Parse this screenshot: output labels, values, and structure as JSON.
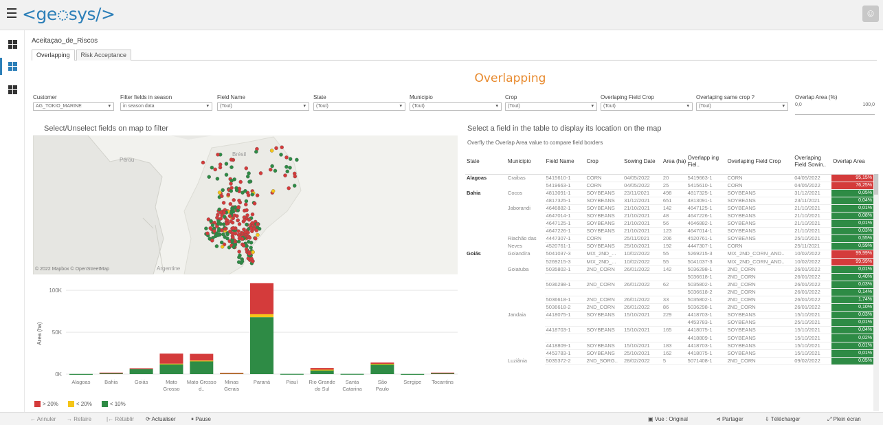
{
  "app": {
    "logo_prefix": "<ge",
    "logo_suffix": "sys/>",
    "avatar": "☺"
  },
  "sidenav": {
    "icons": [
      "dashboard-icon",
      "dashboard-icon",
      "dashboard-icon"
    ]
  },
  "workbook": {
    "title": "Aceitaçao_de_Riscos"
  },
  "tabs": [
    {
      "label": "Overlapping"
    },
    {
      "label": "Risk Acceptance"
    }
  ],
  "dashboard": {
    "title": "Overlapping"
  },
  "filters": [
    {
      "label": "Customer",
      "value": "AG_TOKIO_MARINE"
    },
    {
      "label": "Filter fields in season",
      "value": "in season data"
    },
    {
      "label": "Field Name",
      "value": "(Tout)"
    },
    {
      "label": "State",
      "value": "(Tout)"
    },
    {
      "label": "Municipio",
      "value": "(Tout)"
    },
    {
      "label": "Crop",
      "value": "(Tout)"
    },
    {
      "label": "Overlaping Field Crop",
      "value": "(Tout)"
    },
    {
      "label": "Overlaping same crop ?",
      "value": "(Tout)"
    }
  ],
  "overlap_filter": {
    "label": "Overlap Area (%)",
    "min": "0,0",
    "max": "100,0"
  },
  "map": {
    "title": "Select/Unselect fields on map to filter",
    "labels": {
      "peru": "Pérou",
      "argentina": "Argentine",
      "brazil": "Brésil"
    },
    "attribution": "© 2022 Mapbox © OpenStreetMap"
  },
  "table_section": {
    "title": "Select a field in the table to display its location on the map",
    "subtitle": "Overfly the Overlap Area value to compare field borders",
    "columns": [
      "State",
      "Municipio",
      "Field Name",
      "Crop",
      "Sowing Date",
      "Area (ha)",
      "Overlapp ing Fiel..",
      "Overlaping Field Crop",
      "Overlaping Field Sowin..",
      "Overlap Area"
    ],
    "rows": [
      {
        "state": "Alagoas",
        "mun": "Craibas",
        "field": "5415610-1",
        "crop": "CORN",
        "date": "04/05/2022",
        "area": "20",
        "ofield": "5419663-1",
        "ocrop": "CORN",
        "odate": "04/05/2022",
        "overlap": "95,15%",
        "level": "high"
      },
      {
        "state": "",
        "mun": "",
        "field": "5419663-1",
        "crop": "CORN",
        "date": "04/05/2022",
        "area": "25",
        "ofield": "5415610-1",
        "ocrop": "CORN",
        "odate": "04/05/2022",
        "overlap": "76,25%",
        "level": "high"
      },
      {
        "state": "Bahia",
        "mun": "Cocos",
        "field": "4813091-1",
        "crop": "SOYBEANS",
        "date": "23/11/2021",
        "area": "498",
        "ofield": "4817325-1",
        "ocrop": "SOYBEANS",
        "odate": "31/12/2021",
        "overlap": "0,05%",
        "level": "low"
      },
      {
        "state": "",
        "mun": "",
        "field": "4817325-1",
        "crop": "SOYBEANS",
        "date": "31/12/2021",
        "area": "651",
        "ofield": "4813091-1",
        "ocrop": "SOYBEANS",
        "odate": "23/11/2021",
        "overlap": "0,04%",
        "level": "low"
      },
      {
        "state": "",
        "mun": "Jaborandi",
        "field": "4646882-1",
        "crop": "SOYBEANS",
        "date": "21/10/2021",
        "area": "142",
        "ofield": "4647125-1",
        "ocrop": "SOYBEANS",
        "odate": "21/10/2021",
        "overlap": "0,01%",
        "level": "low"
      },
      {
        "state": "",
        "mun": "",
        "field": "4647014-1",
        "crop": "SOYBEANS",
        "date": "21/10/2021",
        "area": "48",
        "ofield": "4647226-1",
        "ocrop": "SOYBEANS",
        "odate": "21/10/2021",
        "overlap": "0,08%",
        "level": "low"
      },
      {
        "state": "",
        "mun": "",
        "field": "4647125-1",
        "crop": "SOYBEANS",
        "date": "21/10/2021",
        "area": "56",
        "ofield": "4646882-1",
        "ocrop": "SOYBEANS",
        "odate": "21/10/2021",
        "overlap": "0,01%",
        "level": "low"
      },
      {
        "state": "",
        "mun": "",
        "field": "4647226-1",
        "crop": "SOYBEANS",
        "date": "21/10/2021",
        "area": "123",
        "ofield": "4647014-1",
        "ocrop": "SOYBEANS",
        "odate": "21/10/2021",
        "overlap": "0,03%",
        "level": "low"
      },
      {
        "state": "",
        "mun": "Riachão das",
        "field": "4447307-1",
        "crop": "CORN",
        "date": "25/11/2021",
        "area": "206",
        "ofield": "4520761-1",
        "ocrop": "SOYBEANS",
        "odate": "25/10/2021",
        "overlap": "0,55%",
        "level": "low"
      },
      {
        "state": "",
        "mun": "Neves",
        "field": "4520761-1",
        "crop": "SOYBEANS",
        "date": "25/10/2021",
        "area": "192",
        "ofield": "4447307-1",
        "ocrop": "CORN",
        "odate": "25/11/2021",
        "overlap": "0,59%",
        "level": "low"
      },
      {
        "state": "Goiás",
        "mun": "Goiandira",
        "field": "5041037-3",
        "crop": "MIX_2ND_...",
        "date": "10/02/2022",
        "area": "55",
        "ofield": "5269215-3",
        "ocrop": "MIX_2ND_CORN_AND..",
        "odate": "10/02/2022",
        "overlap": "99,99%",
        "level": "high"
      },
      {
        "state": "",
        "mun": "",
        "field": "5269215-3",
        "crop": "MIX_2ND_...",
        "date": "10/02/2022",
        "area": "55",
        "ofield": "5041037-3",
        "ocrop": "MIX_2ND_CORN_AND..",
        "odate": "10/02/2022",
        "overlap": "99,99%",
        "level": "high"
      },
      {
        "state": "",
        "mun": "Goiatuba",
        "field": "5035802-1",
        "crop": "2ND_CORN",
        "date": "26/01/2022",
        "area": "142",
        "ofield": "5036298-1",
        "ocrop": "2ND_CORN",
        "odate": "26/01/2022",
        "overlap": "0,01%",
        "level": "low"
      },
      {
        "state": "",
        "mun": "",
        "field": "",
        "crop": "",
        "date": "",
        "area": "",
        "ofield": "5036618-1",
        "ocrop": "2ND_CORN",
        "odate": "26/01/2022",
        "overlap": "0,40%",
        "level": "low"
      },
      {
        "state": "",
        "mun": "",
        "field": "5036298-1",
        "crop": "2ND_CORN",
        "date": "26/01/2022",
        "area": "62",
        "ofield": "5035802-1",
        "ocrop": "2ND_CORN",
        "odate": "26/01/2022",
        "overlap": "0,03%",
        "level": "low"
      },
      {
        "state": "",
        "mun": "",
        "field": "",
        "crop": "",
        "date": "",
        "area": "",
        "ofield": "5036618-2",
        "ocrop": "2ND_CORN",
        "odate": "26/01/2022",
        "overlap": "0,14%",
        "level": "low"
      },
      {
        "state": "",
        "mun": "",
        "field": "5036618-1",
        "crop": "2ND_CORN",
        "date": "26/01/2022",
        "area": "33",
        "ofield": "5035802-1",
        "ocrop": "2ND_CORN",
        "odate": "26/01/2022",
        "overlap": "1,74%",
        "level": "low"
      },
      {
        "state": "",
        "mun": "",
        "field": "5036618-2",
        "crop": "2ND_CORN",
        "date": "26/01/2022",
        "area": "86",
        "ofield": "5036298-1",
        "ocrop": "2ND_CORN",
        "odate": "26/01/2022",
        "overlap": "0,10%",
        "level": "low"
      },
      {
        "state": "",
        "mun": "Jandaia",
        "field": "4418075-1",
        "crop": "SOYBEANS",
        "date": "15/10/2021",
        "area": "229",
        "ofield": "4418703-1",
        "ocrop": "SOYBEANS",
        "odate": "15/10/2021",
        "overlap": "0,03%",
        "level": "low"
      },
      {
        "state": "",
        "mun": "",
        "field": "",
        "crop": "",
        "date": "",
        "area": "",
        "ofield": "4453783-1",
        "ocrop": "SOYBEANS",
        "odate": "25/10/2021",
        "overlap": "0,01%",
        "level": "low"
      },
      {
        "state": "",
        "mun": "",
        "field": "4418703-1",
        "crop": "SOYBEANS",
        "date": "15/10/2021",
        "area": "165",
        "ofield": "4418075-1",
        "ocrop": "SOYBEANS",
        "odate": "15/10/2021",
        "overlap": "0,04%",
        "level": "low"
      },
      {
        "state": "",
        "mun": "",
        "field": "",
        "crop": "",
        "date": "",
        "area": "",
        "ofield": "4418809-1",
        "ocrop": "SOYBEANS",
        "odate": "15/10/2021",
        "overlap": "0,02%",
        "level": "low"
      },
      {
        "state": "",
        "mun": "",
        "field": "4418809-1",
        "crop": "SOYBEANS",
        "date": "15/10/2021",
        "area": "183",
        "ofield": "4418703-1",
        "ocrop": "SOYBEANS",
        "odate": "15/10/2021",
        "overlap": "0,01%",
        "level": "low"
      },
      {
        "state": "",
        "mun": "",
        "field": "4453783-1",
        "crop": "SOYBEANS",
        "date": "25/10/2021",
        "area": "162",
        "ofield": "4418075-1",
        "ocrop": "SOYBEANS",
        "odate": "15/10/2021",
        "overlap": "0,01%",
        "level": "low"
      },
      {
        "state": "",
        "mun": "Luziânia",
        "field": "5035372-2",
        "crop": "2ND_SORG..",
        "date": "28/02/2022",
        "area": "5",
        "ofield": "5071408-1",
        "ocrop": "2ND_CORN",
        "odate": "09/02/2022",
        "overlap": "0,05%",
        "level": "low"
      }
    ]
  },
  "colors": {
    "high": "#d43b3b",
    "mid": "#f5c518",
    "low": "#2e8b45",
    "accent": "#e88a2e",
    "brand": "#2c7fb8"
  },
  "chart_data": {
    "type": "bar",
    "stacked": true,
    "ylabel": "Area (ha)",
    "yticks": [
      "0K",
      "50K",
      "100K"
    ],
    "ylim": [
      0,
      110000
    ],
    "categories": [
      "Alagoas",
      "Bahia",
      "Goiás",
      "Mato Grosso",
      "Mato Grosso d..",
      "Minas Gerais",
      "Paraná",
      "Piauí",
      "Rio Grande do Sul",
      "Santa Catarina",
      "São Paulo",
      "Sergipe",
      "Tocantins"
    ],
    "series": [
      {
        "name": "< 10%",
        "values": [
          200,
          1500,
          6000,
          12000,
          16000,
          1000,
          68000,
          300,
          5000,
          300,
          12000,
          200,
          1500
        ]
      },
      {
        "name": "< 20%",
        "values": [
          0,
          0,
          0,
          500,
          200,
          300,
          3500,
          0,
          300,
          0,
          300,
          0,
          0
        ]
      },
      {
        "name": "> 20%",
        "values": [
          0,
          300,
          1000,
          12000,
          8000,
          300,
          37000,
          0,
          2000,
          0,
          1500,
          0,
          300
        ]
      }
    ],
    "legend": [
      {
        "label": "> 20%",
        "color": "#d43b3b"
      },
      {
        "label": "< 20%",
        "color": "#f5c518"
      },
      {
        "label": "< 10%",
        "color": "#2e8b45"
      }
    ]
  },
  "bottombar": {
    "undo": "Annuler",
    "redo": "Refaire",
    "revert": "Rétablir",
    "refresh": "Actualiser",
    "pause": "Pause",
    "view": "Vue : Original",
    "share": "Partager",
    "download": "Télécharger",
    "fullscreen": "Plein écran"
  }
}
